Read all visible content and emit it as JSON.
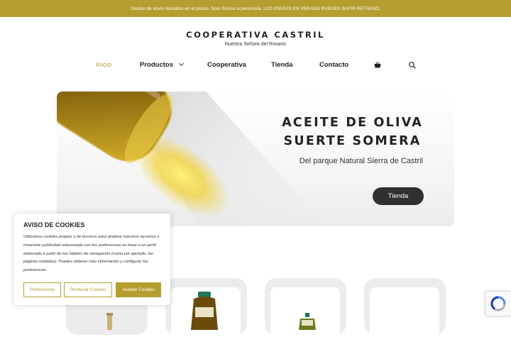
{
  "announcement": "Gastos de envío incluidos en el precio. Solo Envíos a península. LOS ENVÍOS EN VERANO PUEDEN SUFIR RETRASO.",
  "brand": {
    "title": "COOPERATIVA CASTRIL",
    "subtitle": "Nuestra Señora del Rosario"
  },
  "nav": {
    "items": [
      {
        "label": "Inicio"
      },
      {
        "label": "Productos"
      },
      {
        "label": "Cooperativa"
      },
      {
        "label": "Tienda"
      },
      {
        "label": "Contacto"
      }
    ],
    "cart_icon": "shopping-basket-icon",
    "search_icon": "search-icon"
  },
  "hero": {
    "title_line1": "ACEITE DE OLIVA",
    "title_line2": "SUERTE SOMERA",
    "subtitle": "Del parque Natural Sierra de Castril",
    "button": "Tienda"
  },
  "cookie": {
    "title": "AVISO DE COOKIES",
    "text": "Utilizamos cookies propias y de terceros para analizar nuestros servicios y mostrarte publicidad relacionada con tus preferencias en base a un perfil elaborado a partir de tus hábitos de navegación (como por ejemplo, las páginas visitadas). Puedes obtener más información y configurar tus preferencias",
    "buttons": {
      "preferences": "Preferencias",
      "reject": "Rechazar Cookies",
      "accept": "Aceptar Cookies"
    }
  },
  "colors": {
    "accent": "#b59d2f",
    "dark_button": "#303030"
  }
}
